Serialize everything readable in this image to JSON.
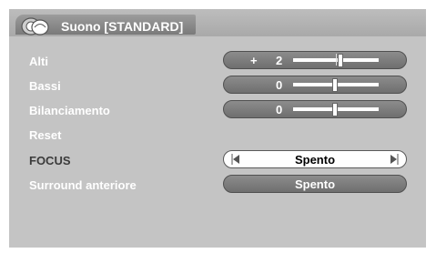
{
  "header": {
    "title": "Suono [STANDARD]",
    "icon": "speaker-icon"
  },
  "rows": [
    {
      "label": "Alti",
      "sign": "+",
      "value": "2",
      "slider_level": 2
    },
    {
      "label": "Bassi",
      "value": "0",
      "slider_level": 0
    },
    {
      "label": "Bilanciamento",
      "value": "0",
      "slider_level": 0
    },
    {
      "label": "Reset"
    },
    {
      "label": "FOCUS",
      "option": "Spento"
    },
    {
      "label": "Surround anteriore",
      "option": "Spento"
    }
  ],
  "colors": {
    "panel": "#c4c4c4",
    "capsule": "#7a7a7a",
    "selected_capsule": "#ffffff"
  }
}
